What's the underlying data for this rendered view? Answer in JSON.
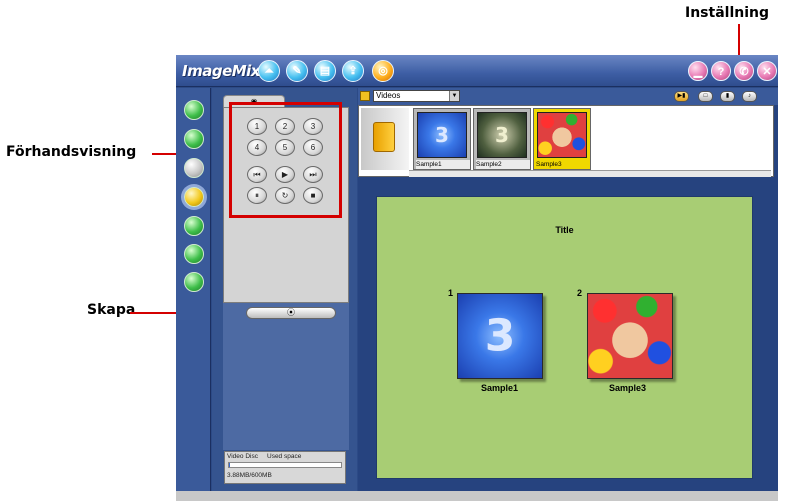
{
  "callouts": {
    "settings": "Inställning",
    "preview": "Förhandsvisning",
    "create": "Skapa"
  },
  "app": {
    "logo": "ImageMixer",
    "title_buttons": [
      "capture-icon",
      "edit-icon",
      "album-icon",
      "export-icon",
      "disc-icon"
    ],
    "window_buttons": [
      "minimize-icon",
      "help-icon",
      "settings-icon",
      "close-icon"
    ]
  },
  "left_tools": [
    "pointer-tool-icon",
    "list-tool-icon",
    "blank-tool-icon",
    "disc-tool-icon",
    "save-tool-icon",
    "document-tool-icon",
    "export-tool-icon"
  ],
  "panel": {
    "tab_glyph": "◉",
    "keypad": [
      "1",
      "2",
      "3",
      "4",
      "5",
      "6",
      "⏮",
      "▶",
      "⏭",
      "⏸",
      "↻",
      "■"
    ],
    "create_glyph": "⦿",
    "disc_label": "Video Disc",
    "used_label": "Used space",
    "disc_usage": "3.88MB/600MB",
    "disc_fraction": 0.0065
  },
  "browser": {
    "folder_select": "Videos",
    "view_buttons": [
      "▶▮",
      "□",
      "▮",
      "♪"
    ],
    "thumbnails": [
      {
        "caption": "Sample1",
        "glyph": "3"
      },
      {
        "caption": "Sample2",
        "glyph": "3"
      },
      {
        "caption": "Sample3",
        "glyph": ""
      }
    ]
  },
  "canvas": {
    "title": "Title",
    "items": [
      {
        "number": "1",
        "caption": "Sample1",
        "glyph": "3"
      },
      {
        "number": "2",
        "caption": "Sample3",
        "glyph": ""
      }
    ]
  },
  "colors": {
    "accent_red": "#d40000",
    "canvas_green": "#a8cd74",
    "window_blue": "#2c4a86"
  }
}
